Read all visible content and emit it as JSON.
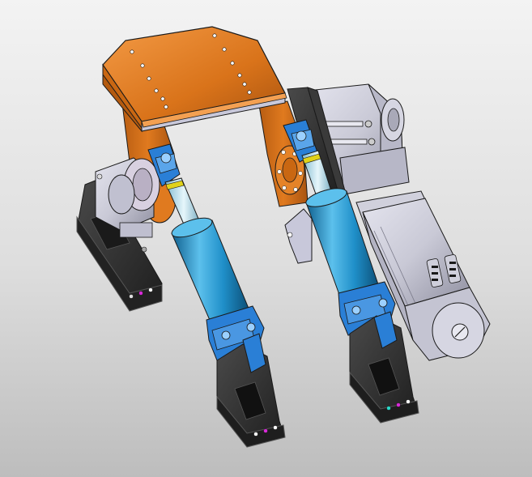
{
  "scene": {
    "background": {
      "top": "#f3f3f3",
      "bottom": "#bdbdbd"
    },
    "colors": {
      "frame_orange": "#d9731a",
      "frame_orange_dark": "#a95410",
      "frame_orange_light": "#f0913a",
      "cylinder_blue": "#1f8fc9",
      "cylinder_blue_dark": "#0f5f8e",
      "cylinder_blue_light": "#5cc0ec",
      "clevis_blue": "#2a7fd6",
      "rod_light": "#b8e2f0",
      "bracket_black": "#2b2b2b",
      "bracket_edge": "#555555",
      "motor_grey": "#c9c9d6",
      "motor_grey_dark": "#8f8fa0",
      "plate_grey": "#c7c7d9",
      "accent_yellow": "#e1d21a",
      "edge_line": "#1a1a1a"
    },
    "parts": [
      "top-plate",
      "orange-yoke-frame",
      "left-pillow-block",
      "left-base-bracket",
      "left-actuator",
      "right-actuator",
      "left-floor-clevis",
      "right-floor-clevis",
      "gearbox",
      "servo-motor",
      "motor-mount-plate",
      "side-support-bracket"
    ]
  }
}
